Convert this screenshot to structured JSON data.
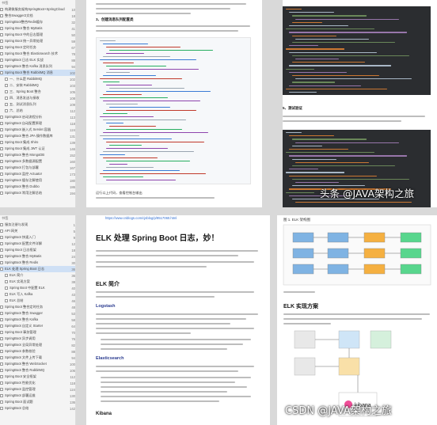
{
  "toc_top": {
    "head": "书签",
    "items": [
      {
        "label": "构建微服务架构SpringBoot+SpringCloud",
        "page": "10"
      },
      {
        "label": "整合Swagger2文档",
        "page": "18"
      },
      {
        "label": "SpringBoot整合Redis缓存",
        "page": "32"
      },
      {
        "label": "Spring Boot 整合 MyBatis",
        "page": "41"
      },
      {
        "label": "Spring Boot 中的日志管理",
        "page": "50"
      },
      {
        "label": "Spring Boot 统一异常处理",
        "page": "59"
      },
      {
        "label": "Spring Boot 定时任务",
        "page": "67"
      },
      {
        "label": "Spring Boot 整合 Elasticsearch 技术",
        "page": "78"
      },
      {
        "label": "SpringBoot 日志 ELK 实战",
        "page": "88"
      },
      {
        "label": "SpringBoot 整合 Kafka 消息队列",
        "page": "94"
      },
      {
        "label": "Spring Boot 整合 RabbitMQ 消息",
        "page": "102"
      },
      {
        "label": "一、什么是 RabbitMQ",
        "page": "102"
      },
      {
        "label": "二、安装 RabbitMQ",
        "page": "103"
      },
      {
        "label": "三、Spring Boot 整合",
        "page": "105"
      },
      {
        "label": "四、消息发送与接收",
        "page": "108"
      },
      {
        "label": "五、测试消息队列",
        "page": "109"
      },
      {
        "label": "六、总结",
        "page": "112"
      },
      {
        "label": "SpringBoot 启动流程分析",
        "page": "113"
      },
      {
        "label": "SpringBoot 自动配置原理",
        "page": "118"
      },
      {
        "label": "SpringBoot 嵌入式 Servlet 容器",
        "page": "124"
      },
      {
        "label": "SpringBoot 整合 JPA 操作数据库",
        "page": "131"
      },
      {
        "label": "Spring Boot 集成 Shiro",
        "page": "139"
      },
      {
        "label": "Spring Boot 集成 JWT 认证",
        "page": "146"
      },
      {
        "label": "SpringBoot 整合 MongoDB",
        "page": "152"
      },
      {
        "label": "SpringBoot 多数据源配置",
        "page": "160"
      },
      {
        "label": "SpringBoot 打包与部署",
        "page": "167"
      },
      {
        "label": "SpringBoot 监控 Actuator",
        "page": "173"
      },
      {
        "label": "SpringBoot 缓存注解使用",
        "page": "180"
      },
      {
        "label": "SpringBoot 整合 Dubbo",
        "page": "186"
      },
      {
        "label": "SpringBoot 常用注解总结",
        "page": "194"
      }
    ]
  },
  "toc_bottom": {
    "head": "书签",
    "items": [
      {
        "label": "服务注册与发现",
        "page": "1"
      },
      {
        "label": "API 网关",
        "page": "5"
      },
      {
        "label": "SpringBoot 快速入门",
        "page": "9"
      },
      {
        "label": "SpringBoot 配置文件详解",
        "page": "12"
      },
      {
        "label": "Spring Boot 日志框架",
        "page": "18"
      },
      {
        "label": "SpringBoot 整合 MyBatis",
        "page": "24"
      },
      {
        "label": "SpringBoot 整合 Redis",
        "page": "30"
      },
      {
        "label": "ELK 处理 Spring Boot 日志",
        "page": "36"
      },
      {
        "label": "ELK 简介",
        "page": "36"
      },
      {
        "label": "ELK 实现方案",
        "page": "38"
      },
      {
        "label": "Spring Boot 中配置 ELK",
        "page": "40"
      },
      {
        "label": "ELK 写入 Kafka",
        "page": "43"
      },
      {
        "label": "ELK 总结",
        "page": "46"
      },
      {
        "label": "Spring Boot 整合定时任务",
        "page": "48"
      },
      {
        "label": "SpringBoot 整合 Swagger",
        "page": "53"
      },
      {
        "label": "SpringBoot 整合 Kafka",
        "page": "58"
      },
      {
        "label": "SpringBoot 自定义 Starter",
        "page": "64"
      },
      {
        "label": "Spring Boot 事务管理",
        "page": "70"
      },
      {
        "label": "SpringBoot 异步调用",
        "page": "76"
      },
      {
        "label": "SpringBoot 全局异常处理",
        "page": "82"
      },
      {
        "label": "SpringBoot 参数校验",
        "page": "88"
      },
      {
        "label": "SpringBoot 文件上传下载",
        "page": "94"
      },
      {
        "label": "SpringBoot 整合 WebSocket",
        "page": "100"
      },
      {
        "label": "SpringBoot 整合 RabbitMQ",
        "page": "106"
      },
      {
        "label": "Spring Boot 安全框架",
        "page": "112"
      },
      {
        "label": "SpringBoot 性能优化",
        "page": "118"
      },
      {
        "label": "SpringBoot 监控管理",
        "page": "124"
      },
      {
        "label": "SpringBoot 部署运维",
        "page": "130"
      },
      {
        "label": "Spring Boot 面试题",
        "page": "136"
      },
      {
        "label": "SpringBoot 总结",
        "page": "142"
      }
    ]
  },
  "page_top_mid": {
    "section_title": "3、创建消息队列配置类",
    "section2_title": "4、编写消息发送者",
    "footer": "运行以上代码，查看控制台输出"
  },
  "page_top_right": {
    "section_title": "5、测试验证",
    "caption": "查看控制台消息接收情况"
  },
  "page_bottom_mid": {
    "link": "https://www.cnblogs.com/cjsblog/p/9517060.html",
    "title": "ELK 处理 Spring Boot 日志，妙！",
    "h_intro": "ELK 简介",
    "h_logstash": "Logstash",
    "h_es": "Elasticsearch",
    "h_kibana": "Kibana"
  },
  "page_bottom_right": {
    "fig_title": "图 1. ELK 架构图",
    "h_solution": "ELK 实现方案",
    "kibana_label": "kibana"
  },
  "watermark_top": "头条 @JAVA架构之旅",
  "watermark_bottom": "CSDN @JAVA架构之旅",
  "colors": {
    "code_bg": "#2b2d30",
    "link": "#2f6dd1",
    "active": "#cfe0f5",
    "kibana": "#f04e98"
  }
}
